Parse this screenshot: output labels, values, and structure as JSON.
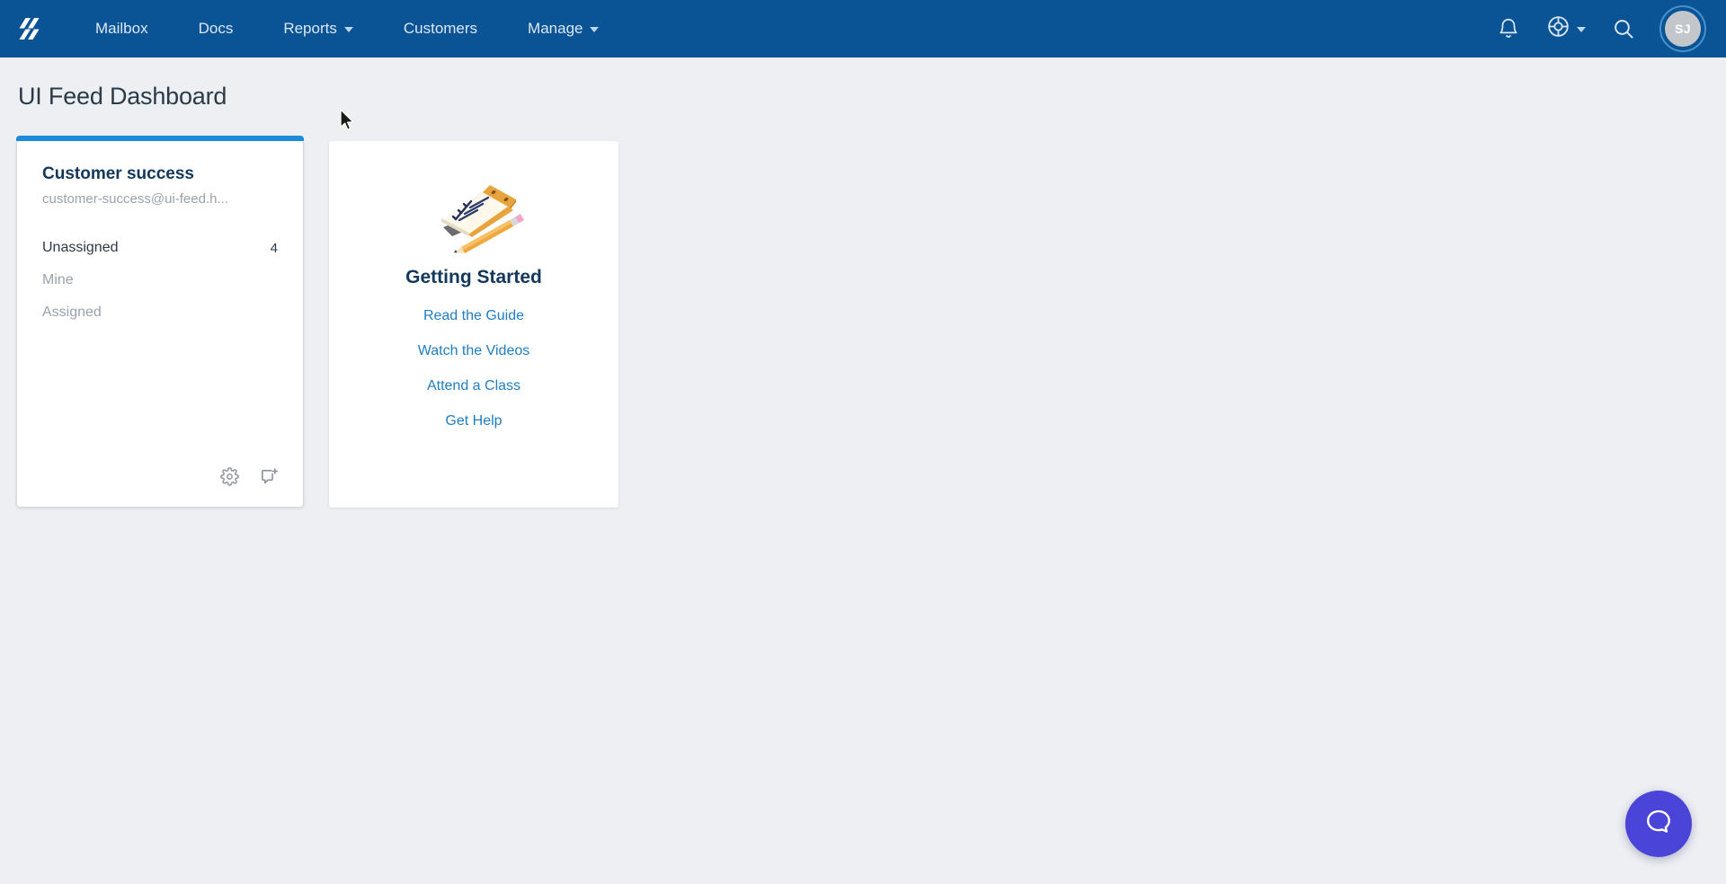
{
  "nav": {
    "logo": "helpscout-logo-icon",
    "links": [
      {
        "label": "Mailbox",
        "has_caret": false
      },
      {
        "label": "Docs",
        "has_caret": false
      },
      {
        "label": "Reports",
        "has_caret": true
      },
      {
        "label": "Customers",
        "has_caret": false
      },
      {
        "label": "Manage",
        "has_caret": true
      }
    ],
    "right": {
      "notifications_icon": "bell-icon",
      "help_icon": "lifebuoy-icon",
      "help_has_caret": true,
      "search_icon": "search-icon",
      "avatar_initials": "SJ"
    }
  },
  "page": {
    "title": "UI Feed Dashboard",
    "background_color": "#edeff3"
  },
  "mailbox_card": {
    "accent_color": "#1b8cdb",
    "name": "Customer success",
    "email": "customer-success@ui-feed.h...",
    "folders": [
      {
        "label": "Unassigned",
        "count": "4",
        "active": true
      },
      {
        "label": "Mine",
        "count": "",
        "active": false
      },
      {
        "label": "Assigned",
        "count": "",
        "active": false
      }
    ],
    "footer": {
      "settings_icon": "gear-icon",
      "new_conversation_icon": "new-conversation-icon"
    }
  },
  "getting_started_card": {
    "illustration": "notepad-pencil-illustration",
    "title": "Getting Started",
    "links": [
      {
        "label": "Read the Guide"
      },
      {
        "label": "Watch the Videos"
      },
      {
        "label": "Attend a Class"
      },
      {
        "label": "Get Help"
      }
    ],
    "link_color": "#1f7ec2"
  },
  "beacon": {
    "icon": "chat-bubble-icon",
    "color": "#4a45d8"
  }
}
